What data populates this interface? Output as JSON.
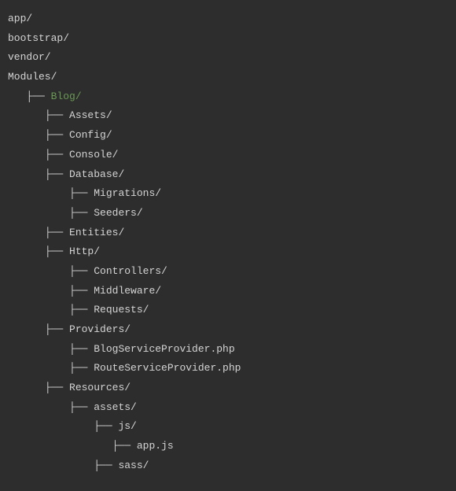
{
  "roots": [
    "app/",
    "bootstrap/",
    "vendor/",
    "Modules/"
  ],
  "module": "Blog/",
  "tree": {
    "assets": "Assets/",
    "config": "Config/",
    "console": "Console/",
    "database": "Database/",
    "migrations": "Migrations/",
    "seeders": "Seeders/",
    "entities": "Entities/",
    "http": "Http/",
    "controllers": "Controllers/",
    "middleware": "Middleware/",
    "requests": "Requests/",
    "providers": "Providers/",
    "blogServiceProvider": "BlogServiceProvider.php",
    "routeServiceProvider": "RouteServiceProvider.php",
    "resources": "Resources/",
    "resourcesAssets": "assets/",
    "js": "js/",
    "appJs": "app.js",
    "sass": "sass/"
  },
  "branches": {
    "b1": "├── ",
    "b2": "|── "
  }
}
